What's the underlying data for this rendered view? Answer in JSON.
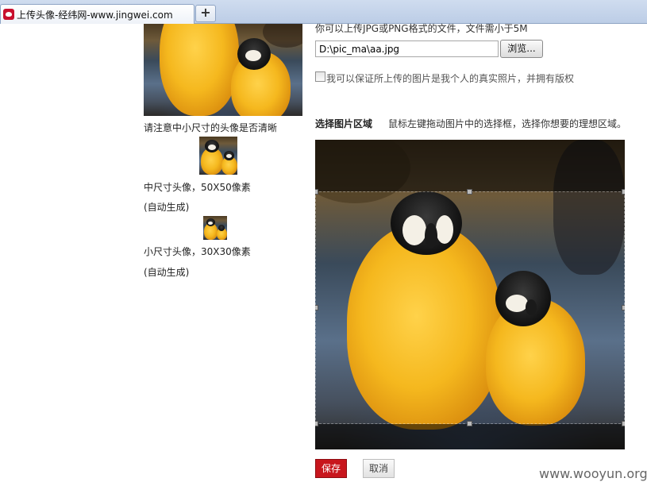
{
  "browser": {
    "tab_title": "上传头像-经纬网-www.jingwei.com",
    "new_tab_label": "+",
    "favicon": "site-favicon"
  },
  "left": {
    "notice": "请注意中小尺寸的头像是否清晰",
    "medium_label": "中尺寸头像，50X50像素",
    "medium_auto": "(自动生成)",
    "small_label": "小尺寸头像，30X30像素",
    "small_auto": "(自动生成)"
  },
  "upload": {
    "hint": "你可以上传JPG或PNG格式的文件，文件需小于5M",
    "file_value": "D:\\pic_ma\\aa.jpg",
    "browse_label": "浏览...",
    "copyright_label": "我可以保证所上传的图片是我个人的真实照片，并拥有版权",
    "copyright_checked": false
  },
  "crop": {
    "title": "选择图片区域",
    "description": "鼠标左键拖动图片中的选择框，选择你想要的理想区域。"
  },
  "actions": {
    "save_label": "保存",
    "cancel_label": "取消"
  },
  "watermark": "www.wooyun.org",
  "colors": {
    "accent_red": "#c8161d",
    "tabstrip": "#cfdcef"
  }
}
